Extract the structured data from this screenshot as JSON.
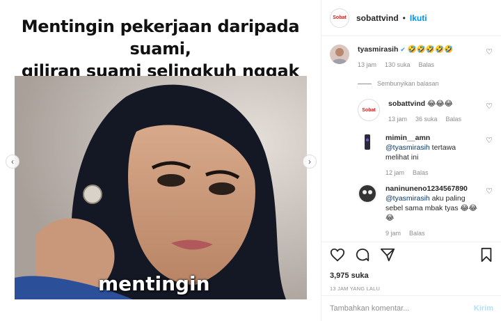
{
  "post": {
    "caption_line1": "Mentingin pekerjaan daripada suami,",
    "caption_line2": "giliran suami selingkuh nggak terima:v",
    "overlay_text": "mentingin"
  },
  "header": {
    "username": "sobattvind",
    "dot": "•",
    "follow_label": "Ikuti",
    "avatar_text": "Sobat"
  },
  "comments": [
    {
      "username": "tyasmirasih",
      "text": "🤣🤣🤣🤣🤣",
      "time": "13 jam",
      "likes": "130 suka",
      "reply": "Balas"
    },
    {
      "username": "sobattvind",
      "text": "😂😂😂",
      "time": "13 jam",
      "likes": "36 suka",
      "reply": "Balas"
    },
    {
      "username": "mimin__amn",
      "mention": "@tyasmirasih",
      "text": " tertawa melihat ini",
      "time": "12 jam",
      "reply": "Balas"
    },
    {
      "username": "naninuneno1234567890",
      "mention": "@tyasmirasih",
      "text": " aku paling sebel sama mbak tyas 😂😂😂",
      "time": "9 jam",
      "reply": "Balas"
    }
  ],
  "hide_replies": "Sembunyikan balasan",
  "actions": {
    "likes": "3,975 suka",
    "time": "13 JAM YANG LALU"
  },
  "composer": {
    "placeholder": "Tambahkan komentar...",
    "post_label": "Kirim"
  },
  "colors": {
    "accent": "#0095f6",
    "mention": "#00376b",
    "muted": "#8e8e8e"
  }
}
